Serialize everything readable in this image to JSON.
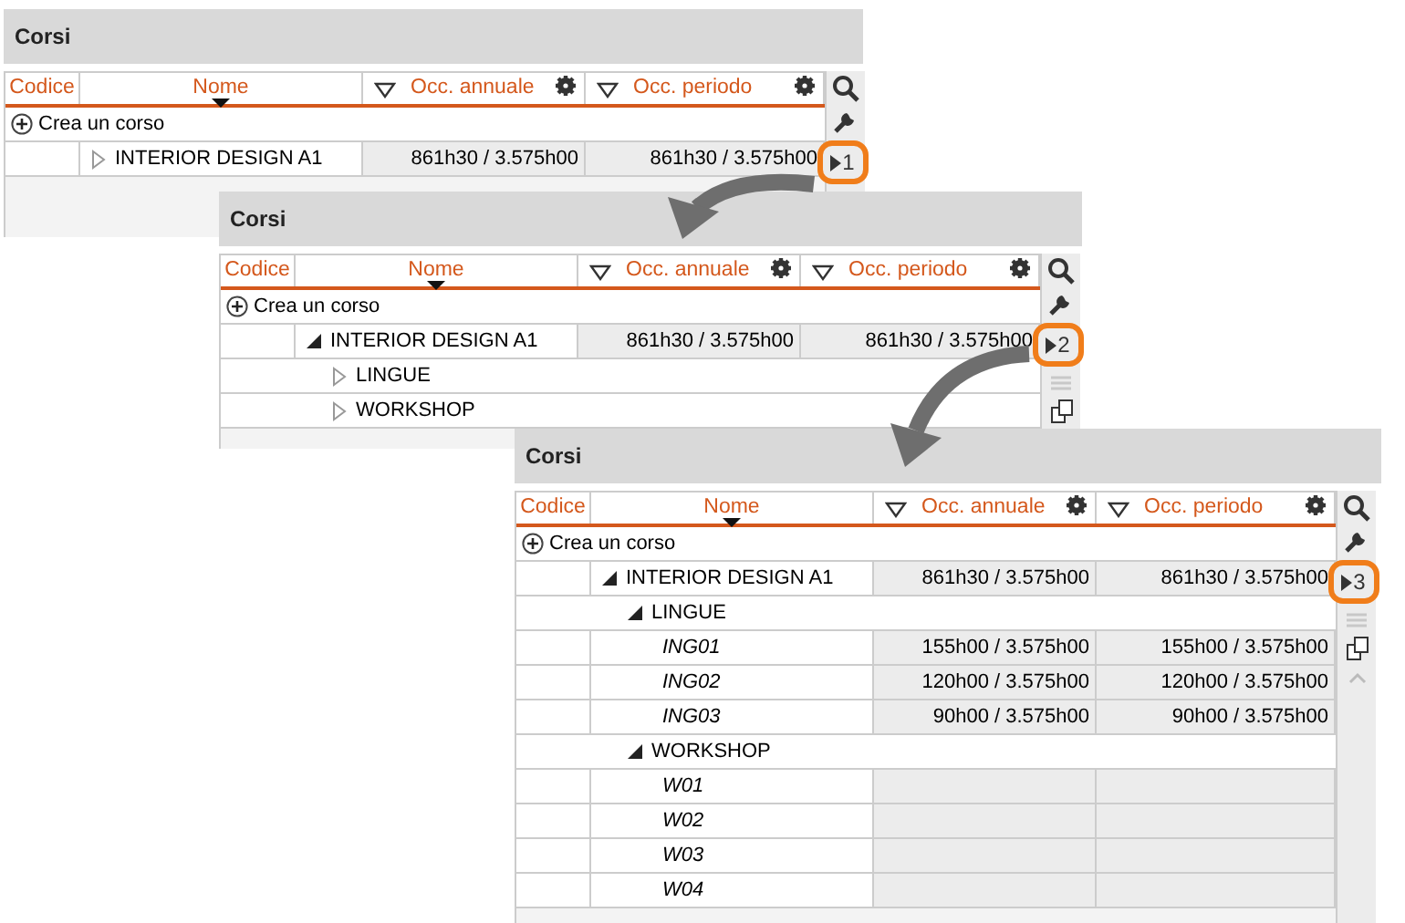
{
  "panels": [
    {
      "title": "Corsi",
      "columns": [
        "Codice",
        "Nome",
        "Occ. annuale",
        "Occ. periodo"
      ],
      "create_label": "Crea un corso",
      "tools": [
        {
          "kind": "search"
        },
        {
          "kind": "wrench"
        },
        {
          "kind": "level",
          "label": "1"
        }
      ],
      "rows": [
        {
          "kind": "group",
          "name": "INTERIOR DESIGN A1",
          "expanded": false,
          "annuale": "861h30 / 3.575h00",
          "periodo": "861h30 / 3.575h00"
        }
      ]
    },
    {
      "title": "Corsi",
      "columns": [
        "Codice",
        "Nome",
        "Occ. annuale",
        "Occ. periodo"
      ],
      "create_label": "Crea un corso",
      "tools": [
        {
          "kind": "search"
        },
        {
          "kind": "wrench"
        },
        {
          "kind": "level",
          "label": "2"
        },
        {
          "kind": "handle"
        },
        {
          "kind": "copy"
        }
      ],
      "rows": [
        {
          "kind": "group",
          "name": "INTERIOR DESIGN A1",
          "expanded": true,
          "annuale": "861h30 / 3.575h00",
          "periodo": "861h30 / 3.575h00",
          "children": [
            {
              "kind": "group",
              "name": "LINGUE",
              "expanded": false
            },
            {
              "kind": "group",
              "name": "WORKSHOP",
              "expanded": false
            }
          ]
        }
      ]
    },
    {
      "title": "Corsi",
      "columns": [
        "Codice",
        "Nome",
        "Occ. annuale",
        "Occ. periodo"
      ],
      "create_label": "Crea un corso",
      "tools": [
        {
          "kind": "search"
        },
        {
          "kind": "wrench"
        },
        {
          "kind": "level",
          "label": "3"
        },
        {
          "kind": "handle"
        },
        {
          "kind": "copy"
        },
        {
          "kind": "up"
        }
      ],
      "rows": [
        {
          "kind": "group",
          "name": "INTERIOR DESIGN A1",
          "expanded": true,
          "annuale": "861h30 / 3.575h00",
          "periodo": "861h30 / 3.575h00",
          "children": [
            {
              "kind": "group",
              "name": "LINGUE",
              "expanded": true,
              "children": [
                {
                  "kind": "item",
                  "name": "ING01",
                  "annuale": "155h00 / 3.575h00",
                  "periodo": "155h00 / 3.575h00"
                },
                {
                  "kind": "item",
                  "name": "ING02",
                  "annuale": "120h00 / 3.575h00",
                  "periodo": "120h00 / 3.575h00"
                },
                {
                  "kind": "item",
                  "name": "ING03",
                  "annuale": "90h00 / 3.575h00",
                  "periodo": "90h00 / 3.575h00"
                }
              ]
            },
            {
              "kind": "group",
              "name": "WORKSHOP",
              "expanded": true,
              "children": [
                {
                  "kind": "item",
                  "name": "W01"
                },
                {
                  "kind": "item",
                  "name": "W02"
                },
                {
                  "kind": "item",
                  "name": "W03"
                },
                {
                  "kind": "item",
                  "name": "W04"
                }
              ]
            }
          ]
        }
      ]
    }
  ]
}
